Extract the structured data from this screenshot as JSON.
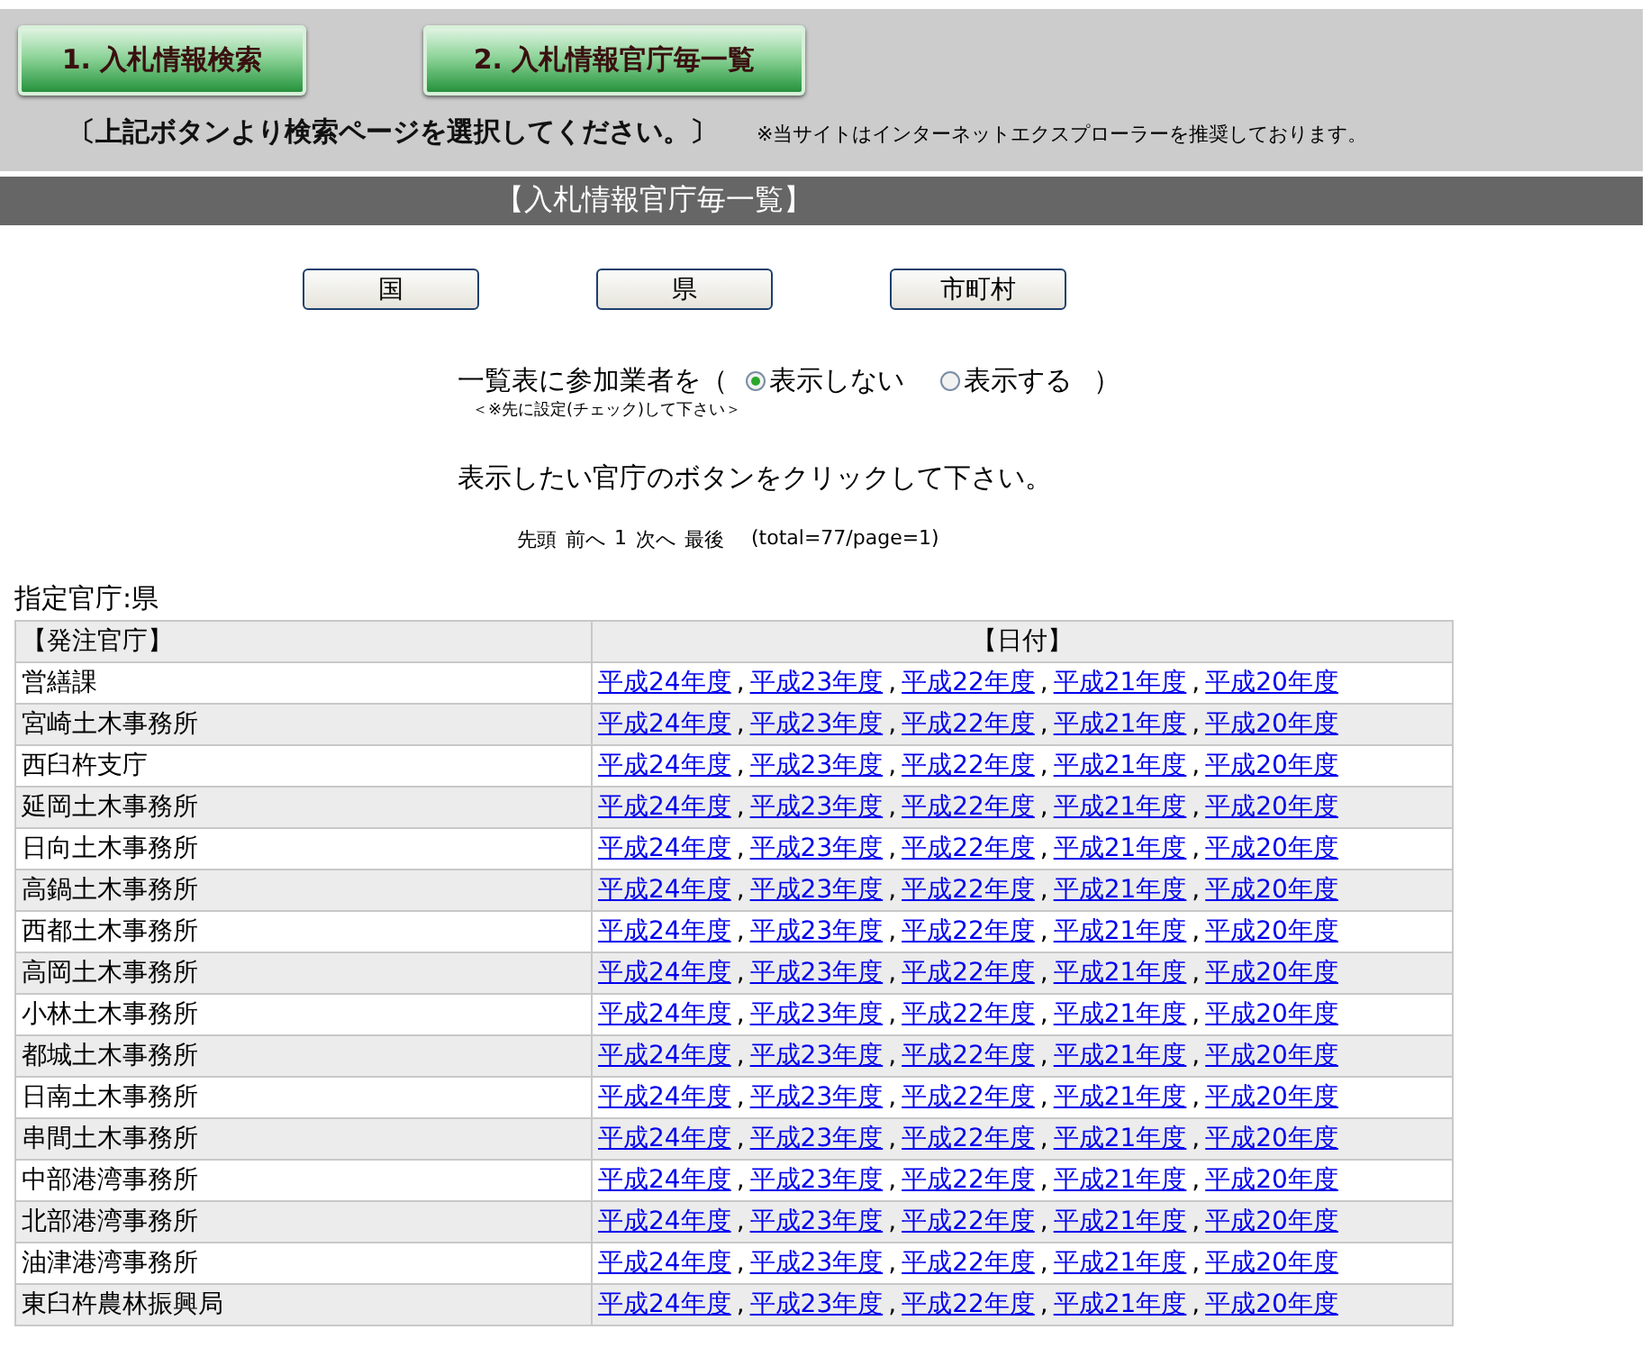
{
  "header": {
    "nav_buttons": [
      "1. 入札情報検索",
      "2. 入札情報官庁毎一覧"
    ],
    "instruction": "〔上記ボタンより検索ページを選択してください。〕",
    "browser_note": "※当サイトはインターネットエクスプローラーを推奨しております。"
  },
  "section_title": "【入札情報官庁毎一覧】",
  "category_buttons": [
    "国",
    "県",
    "市町村"
  ],
  "participants": {
    "label": "一覧表に参加業者を（",
    "close": "）",
    "options": [
      {
        "label": "表示しない",
        "selected": true
      },
      {
        "label": "表示する",
        "selected": false
      }
    ],
    "note": "＜※先に設定(チェック)して下さい＞"
  },
  "prompt": "表示したい官庁のボタンをクリックして下さい。",
  "pager": {
    "items": [
      "先頭",
      "前へ",
      "1",
      "次へ",
      "最後"
    ],
    "summary": "(total=77/page=1)"
  },
  "selected_agency": "指定官庁:県",
  "table": {
    "columns": [
      "【発注官庁】",
      "【日付】"
    ],
    "separator": ",",
    "rows": [
      {
        "agency": "営繕課",
        "years": [
          "平成24年度",
          "平成23年度",
          "平成22年度",
          "平成21年度",
          "平成20年度"
        ]
      },
      {
        "agency": "宮崎土木事務所",
        "years": [
          "平成24年度",
          "平成23年度",
          "平成22年度",
          "平成21年度",
          "平成20年度"
        ]
      },
      {
        "agency": "西臼杵支庁",
        "years": [
          "平成24年度",
          "平成23年度",
          "平成22年度",
          "平成21年度",
          "平成20年度"
        ]
      },
      {
        "agency": "延岡土木事務所",
        "years": [
          "平成24年度",
          "平成23年度",
          "平成22年度",
          "平成21年度",
          "平成20年度"
        ]
      },
      {
        "agency": "日向土木事務所",
        "years": [
          "平成24年度",
          "平成23年度",
          "平成22年度",
          "平成21年度",
          "平成20年度"
        ]
      },
      {
        "agency": "高鍋土木事務所",
        "years": [
          "平成24年度",
          "平成23年度",
          "平成22年度",
          "平成21年度",
          "平成20年度"
        ]
      },
      {
        "agency": "西都土木事務所",
        "years": [
          "平成24年度",
          "平成23年度",
          "平成22年度",
          "平成21年度",
          "平成20年度"
        ]
      },
      {
        "agency": "高岡土木事務所",
        "years": [
          "平成24年度",
          "平成23年度",
          "平成22年度",
          "平成21年度",
          "平成20年度"
        ]
      },
      {
        "agency": "小林土木事務所",
        "years": [
          "平成24年度",
          "平成23年度",
          "平成22年度",
          "平成21年度",
          "平成20年度"
        ]
      },
      {
        "agency": "都城土木事務所",
        "years": [
          "平成24年度",
          "平成23年度",
          "平成22年度",
          "平成21年度",
          "平成20年度"
        ]
      },
      {
        "agency": "日南土木事務所",
        "years": [
          "平成24年度",
          "平成23年度",
          "平成22年度",
          "平成21年度",
          "平成20年度"
        ]
      },
      {
        "agency": "串間土木事務所",
        "years": [
          "平成24年度",
          "平成23年度",
          "平成22年度",
          "平成21年度",
          "平成20年度"
        ]
      },
      {
        "agency": "中部港湾事務所",
        "years": [
          "平成24年度",
          "平成23年度",
          "平成22年度",
          "平成21年度",
          "平成20年度"
        ]
      },
      {
        "agency": "北部港湾事務所",
        "years": [
          "平成24年度",
          "平成23年度",
          "平成22年度",
          "平成21年度",
          "平成20年度"
        ]
      },
      {
        "agency": "油津港湾事務所",
        "years": [
          "平成24年度",
          "平成23年度",
          "平成22年度",
          "平成21年度",
          "平成20年度"
        ]
      },
      {
        "agency": "東臼杵農林振興局",
        "years": [
          "平成24年度",
          "平成23年度",
          "平成22年度",
          "平成21年度",
          "平成20年度"
        ]
      }
    ]
  }
}
